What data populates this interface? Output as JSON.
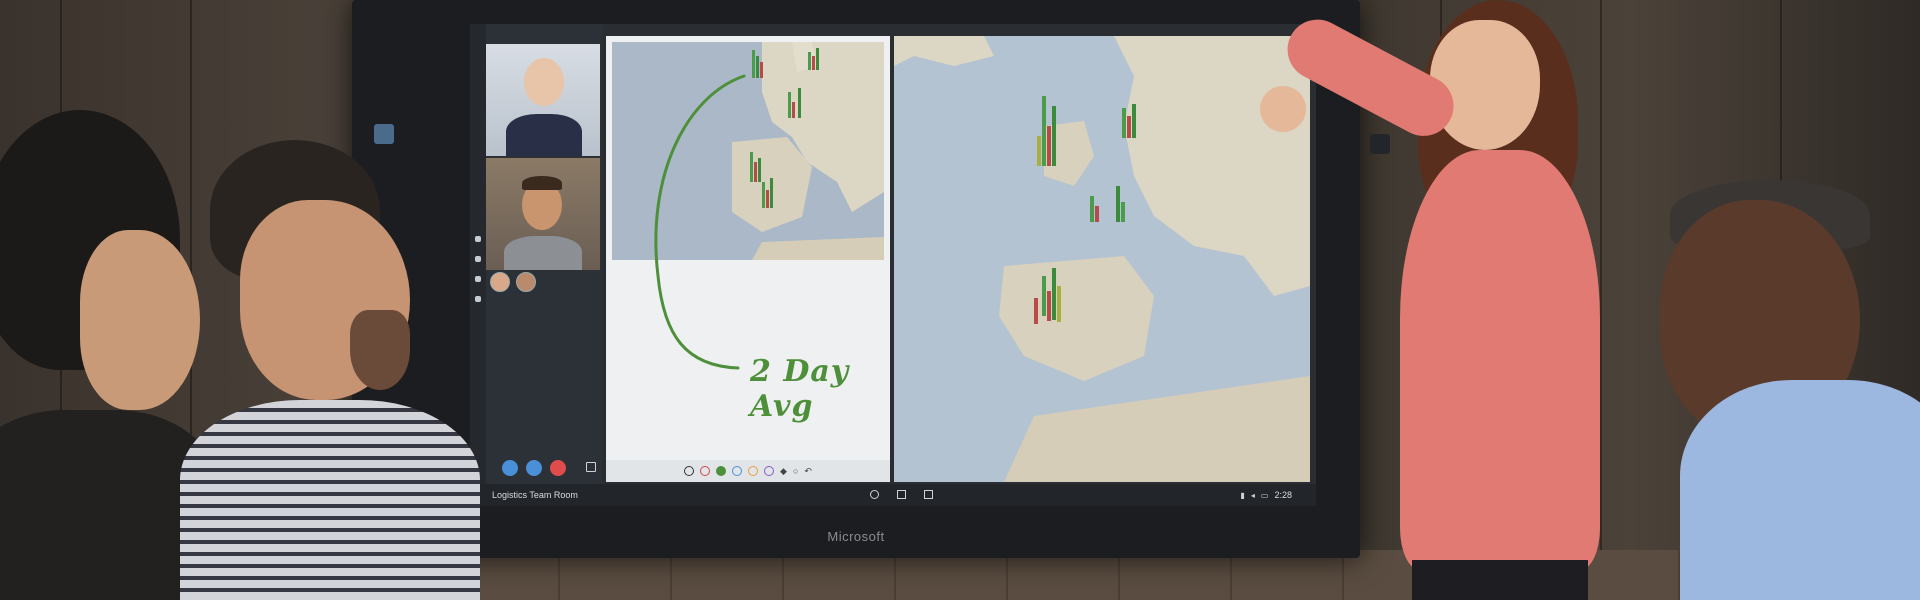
{
  "device": {
    "brand": "Microsoft"
  },
  "screen": {
    "room_name": "Logistics Team Room",
    "clock": "2:28",
    "whiteboard": {
      "ink_annotation": "2 Day Avg"
    },
    "call": {
      "participants": [
        "participant-1",
        "participant-2"
      ]
    }
  },
  "colors": {
    "ink_green": "#4e8f3a",
    "call_red": "#e04b4b",
    "call_blue": "#4a90d9",
    "sweater_coral": "#e07a72"
  }
}
